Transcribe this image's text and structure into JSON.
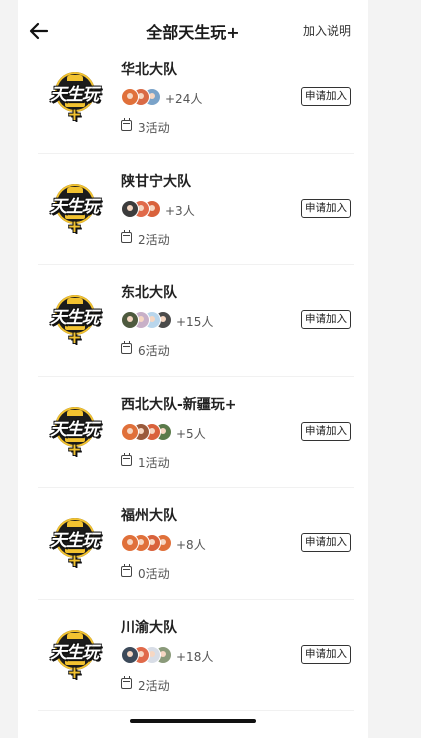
{
  "header": {
    "title": "全部天生玩+",
    "action_label": "加入说明"
  },
  "logo_text": "天生玩+",
  "teams": [
    {
      "name": "华北大队",
      "avatar_colors": [
        "#e0703a",
        "#d96a46",
        "#7aa3c9"
      ],
      "member_count": "+24人",
      "activities": "3活动",
      "join_label": "申请加入"
    },
    {
      "name": "陕甘宁大队",
      "avatar_colors": [
        "#3c3c3c",
        "#e06a4a",
        "#d9623c"
      ],
      "member_count": "+3人",
      "activities": "2活动",
      "join_label": "申请加入"
    },
    {
      "name": "东北大队",
      "avatar_colors": [
        "#4e5a3e",
        "#c8b0c8",
        "#b9d6ec",
        "#4b4b4b"
      ],
      "member_count": "+15人",
      "activities": "6活动",
      "join_label": "申请加入"
    },
    {
      "name": "西北大队-新疆玩+",
      "avatar_colors": [
        "#e0703a",
        "#9a5a3c",
        "#d9623c",
        "#5a7a4a"
      ],
      "member_count": "+5人",
      "activities": "1活动",
      "join_label": "申请加入"
    },
    {
      "name": "福州大队",
      "avatar_colors": [
        "#e0703a",
        "#e0703a",
        "#d9623c",
        "#e0703a"
      ],
      "member_count": "+8人",
      "activities": "0活动",
      "join_label": "申请加入"
    },
    {
      "name": "川渝大队",
      "avatar_colors": [
        "#3c4a5a",
        "#e06a4a",
        "#d8dde6",
        "#8a9a7a"
      ],
      "member_count": "+18人",
      "activities": "2活动",
      "join_label": "申请加入"
    }
  ]
}
